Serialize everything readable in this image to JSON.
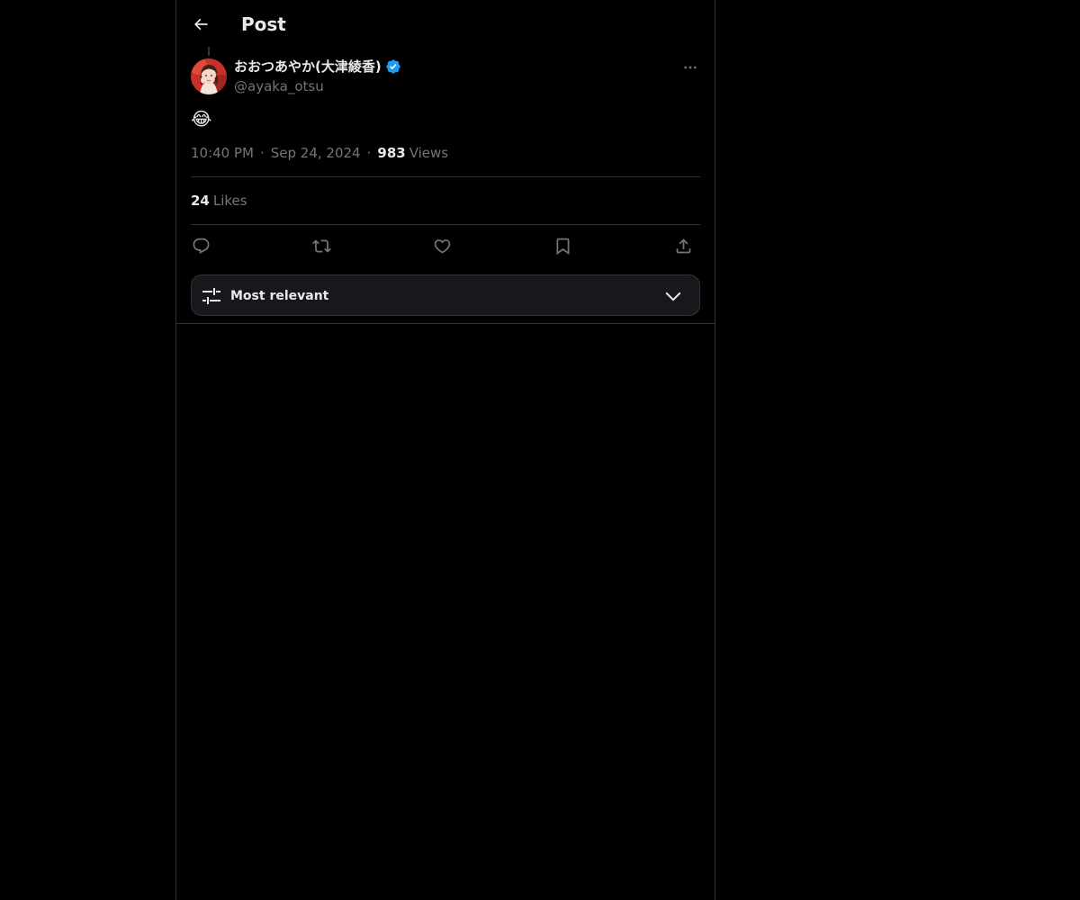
{
  "header": {
    "back_icon": "arrow-left-icon",
    "title": "Post"
  },
  "post": {
    "author": {
      "display_name": "おおつあやか(大津綾香)",
      "handle": "@ayaka_otsu",
      "verified_icon": "verified-badge-icon"
    },
    "more_icon": "more-horizontal-icon",
    "text": "😂",
    "time": "10:40 PM",
    "date": "Sep 24, 2024",
    "separator": "·",
    "views_count": "983",
    "views_label": "Views",
    "likes_count": "24",
    "likes_label": "Likes"
  },
  "actions": [
    "reply-icon",
    "repost-icon",
    "like-icon",
    "bookmark-icon",
    "share-icon"
  ],
  "sort": {
    "icon": "sliders-icon",
    "label": "Most relevant",
    "chevron": "chevron-down-icon"
  },
  "colors": {
    "background": "#000000",
    "text": "#e7e9ea",
    "muted": "#71767b",
    "border": "#2f3336",
    "verified": "#1d9bf0"
  }
}
